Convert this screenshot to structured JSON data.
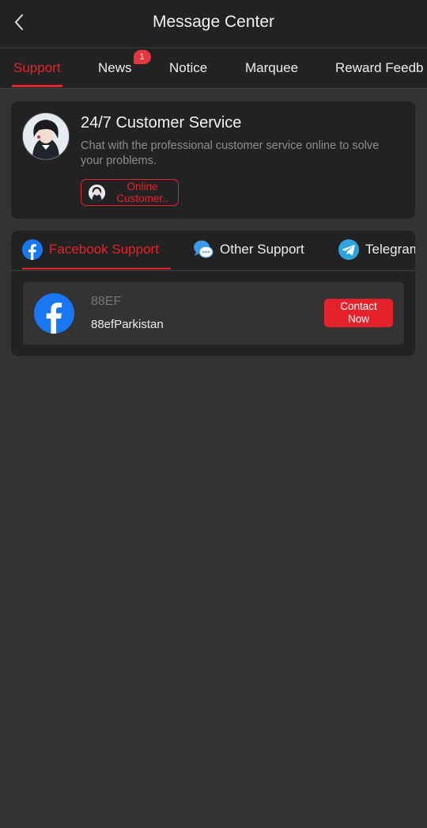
{
  "header": {
    "title": "Message Center",
    "back_icon": "chevron-left-icon"
  },
  "tabs": [
    {
      "label": "Support",
      "active": true
    },
    {
      "label": "News",
      "badge": "1"
    },
    {
      "label": "Notice"
    },
    {
      "label": "Marquee"
    },
    {
      "label": "Reward Feedb"
    }
  ],
  "customer_service": {
    "title": "24/7 Customer Service",
    "description": "Chat with the professional customer service online to solve your problems.",
    "button_line1": "Online",
    "button_line2": "Customer.."
  },
  "support_tabs": [
    {
      "label": "Facebook Support",
      "icon": "facebook-icon",
      "active": true
    },
    {
      "label": "Other Support",
      "icon": "chat-bubble-icon"
    },
    {
      "label": "Telegram",
      "icon": "telegram-icon"
    }
  ],
  "contacts": [
    {
      "name": "88EF",
      "id": "88efParkistan",
      "button": "Contact Now",
      "icon": "facebook-icon"
    }
  ],
  "colors": {
    "accent": "#e5222c",
    "card": "#222222",
    "background": "#333333"
  }
}
